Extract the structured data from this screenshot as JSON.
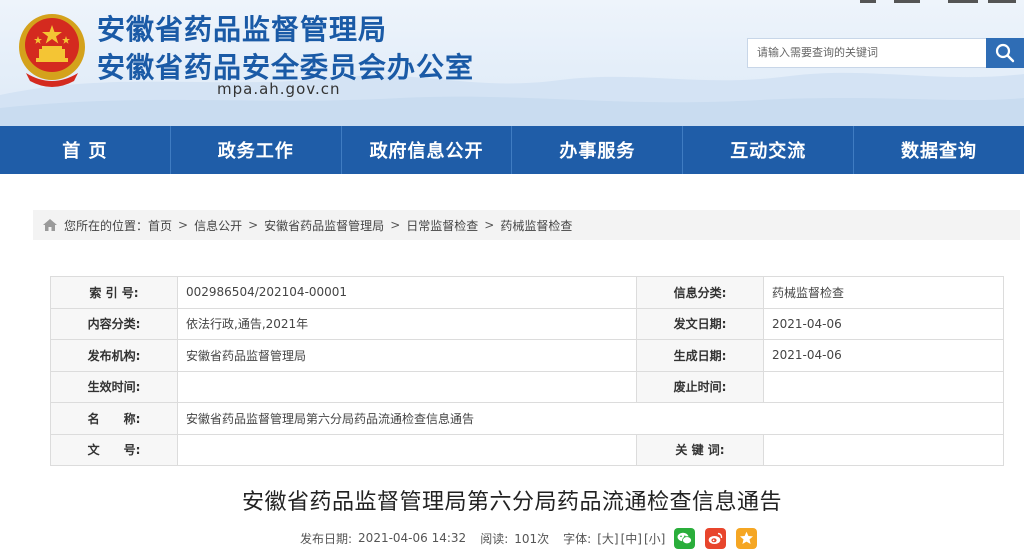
{
  "header": {
    "title_line1": "安徽省药品监督管理局",
    "title_line2": "安徽省药品安全委员会办公室",
    "domain": "mpa.ah.gov.cn",
    "search_placeholder": "请输入需要查询的关键词",
    "colors": {
      "title": "#1a5aa6",
      "nav": "#1f5da8"
    }
  },
  "nav": {
    "items": [
      {
        "label": "首 页"
      },
      {
        "label": "政务工作"
      },
      {
        "label": "政府信息公开"
      },
      {
        "label": "办事服务"
      },
      {
        "label": "互动交流"
      },
      {
        "label": "数据查询"
      }
    ]
  },
  "breadcrumb": {
    "prefix": "您所在的位置：",
    "items": [
      "首页",
      "信息公开",
      "安徽省药品监督管理局",
      "日常监督检查",
      "药械监督检查"
    ]
  },
  "info": {
    "index_label": "索 引 号:",
    "index_value": "002986504/202104-00001",
    "category_label": "信息分类:",
    "category_value": "药械监督检查",
    "content_label": "内容分类:",
    "content_value": "依法行政,通告,2021年",
    "issue_date_label": "发文日期:",
    "issue_date_value": "2021-04-06",
    "org_label": "发布机构:",
    "org_value": "安徽省药品监督管理局",
    "gen_date_label": "生成日期:",
    "gen_date_value": "2021-04-06",
    "effective_label": "生效时间:",
    "effective_value": "",
    "abolish_label": "废止时间:",
    "abolish_value": "",
    "name_label": "名　　称:",
    "name_value": "安徽省药品监督管理局第六分局药品流通检查信息通告",
    "docno_label": "文　　号:",
    "docno_value": "",
    "keyword_label": "关 键 词:",
    "keyword_value": ""
  },
  "article": {
    "title": "安徽省药品监督管理局第六分局药品流通检查信息通告",
    "publish_label": "发布日期:",
    "publish_value": "2021-04-06 14:32",
    "reads_label": "阅读:",
    "reads_value": "101次",
    "font_label": "字体:",
    "font_large": "[大]",
    "font_medium": "[中]",
    "font_small": "[小]"
  },
  "icons": {
    "emblem": "national-emblem-icon",
    "search": "search-icon",
    "home": "home-icon",
    "wechat": "wechat-icon",
    "weibo": "weibo-icon",
    "qzone": "qzone-icon"
  }
}
